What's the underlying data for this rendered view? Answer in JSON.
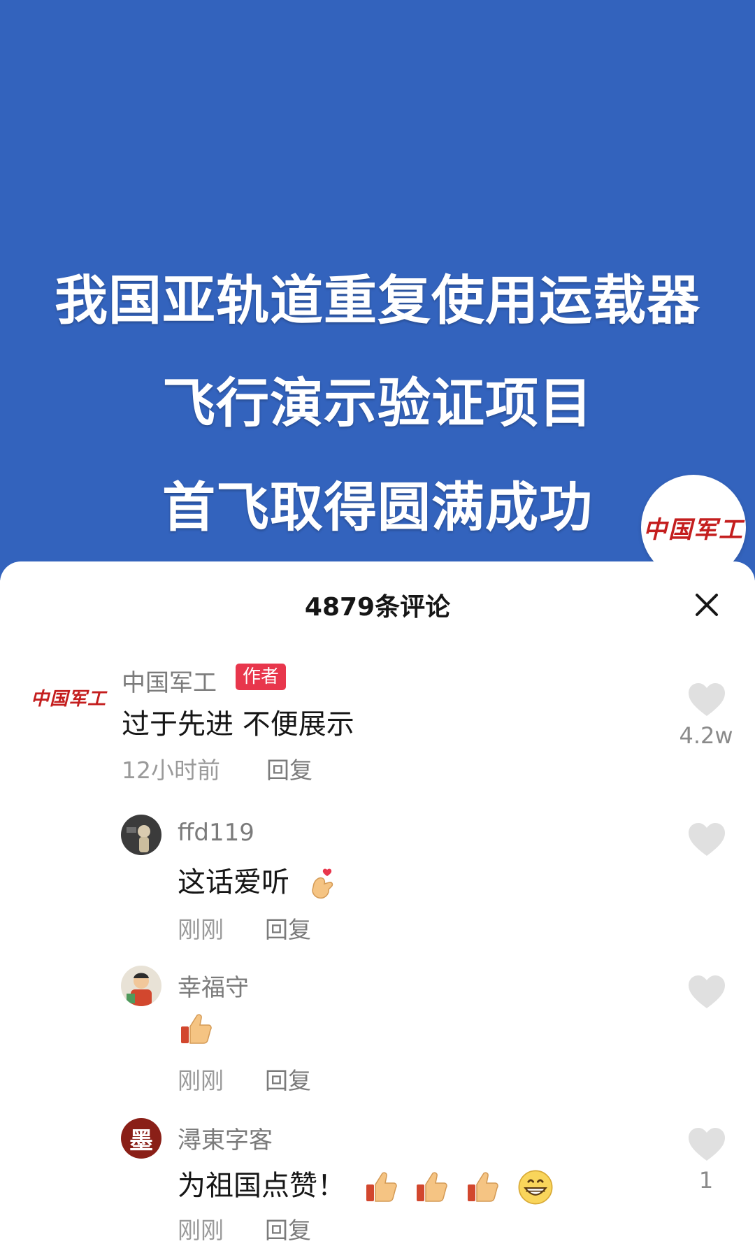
{
  "banner": {
    "headline_lines": [
      "我国亚轨道重复使用运载器",
      "飞行演示验证项目",
      "首飞取得圆满成功"
    ],
    "logo_text": "中国军工",
    "background_color": "#3363bd"
  },
  "comments_panel": {
    "title": "4879条评论",
    "close_icon": "close-icon"
  },
  "comments": [
    {
      "username": "中国军工",
      "author_tag": "作者",
      "avatar_logo_text": "中国军工",
      "text": "过于先进 不便展示",
      "time": "12小时前",
      "reply_label": "回复",
      "like_count": "4.2w"
    },
    {
      "username": "ffd119",
      "text": "这话爱听",
      "emoji": [
        "finger-heart-emoji"
      ],
      "time": "刚刚",
      "reply_label": "回复",
      "like_count": ""
    },
    {
      "username": "幸福守",
      "text": "",
      "emoji": [
        "thumbs-up-emoji"
      ],
      "time": "刚刚",
      "reply_label": "回复",
      "like_count": ""
    },
    {
      "username": "潯東字客",
      "avatar_text": "墨",
      "text": "为祖国点赞！",
      "emoji": [
        "thumbs-up-emoji",
        "thumbs-up-emoji",
        "thumbs-up-emoji",
        "grinning-face-emoji"
      ],
      "time": "刚刚",
      "reply_label": "回复",
      "like_count": "1"
    }
  ],
  "colors": {
    "author_tag": "#e8364c",
    "logo_red": "#c41e1e",
    "like_heart": "#e0e0e0"
  }
}
